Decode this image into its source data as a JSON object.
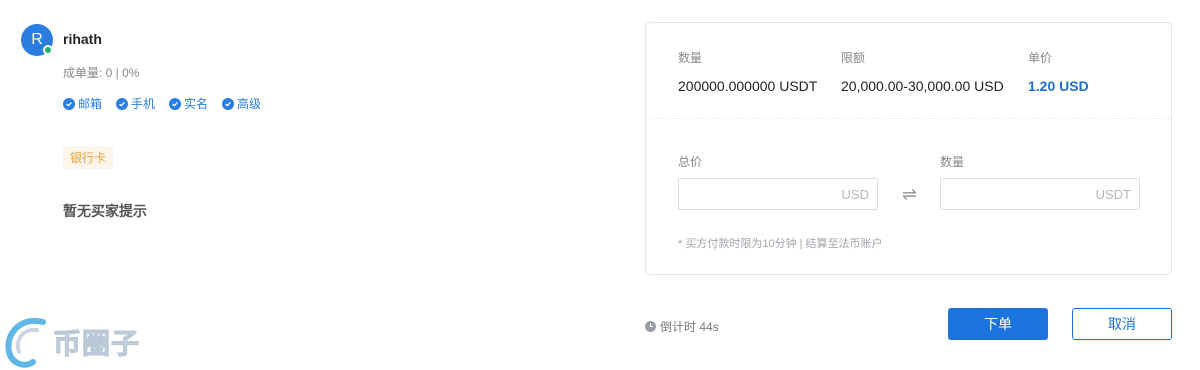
{
  "seller": {
    "avatar_letter": "R",
    "username": "rihath",
    "stats": "成单量: 0 | 0%",
    "verifications": [
      "邮箱",
      "手机",
      "实名",
      "高级"
    ]
  },
  "payment_method": "银行卡",
  "buyer_tip": "暂无买家提示",
  "order": {
    "quantity_label": "数量",
    "quantity_value": "200000.000000 USDT",
    "limit_label": "限额",
    "limit_value": "20,000.00-30,000.00 USD",
    "price_label": "单价",
    "price_value": "1.20 USD"
  },
  "inputs": {
    "total_label": "总价",
    "total_placeholder": "USD",
    "amount_label": "数量",
    "amount_placeholder": "USDT",
    "swap_symbol": "⇌"
  },
  "note": "* 买方付款时限为10分钟  |  结算至法币账户",
  "countdown": "倒计时 44s",
  "buttons": {
    "order": "下单",
    "cancel": "取消"
  },
  "watermark": "币圈子",
  "colors": {
    "accent": "#1a74dc",
    "online": "#17b36c",
    "badge_text": "#e8a23b"
  }
}
